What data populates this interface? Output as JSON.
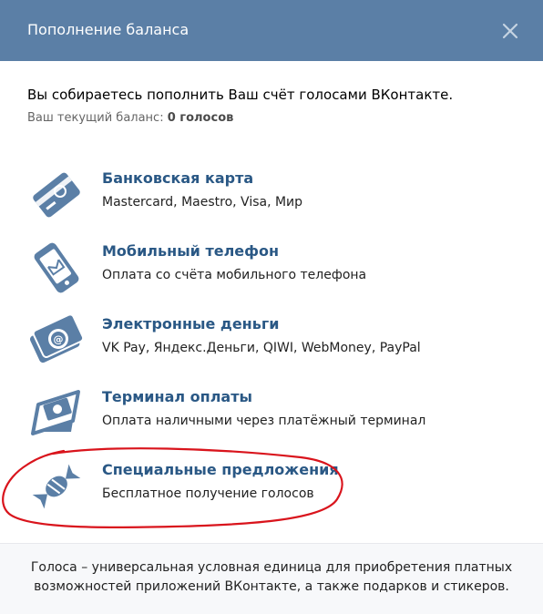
{
  "header": {
    "title": "Пополнение баланса",
    "close_icon": "close-icon",
    "background": "#5b7fa6"
  },
  "intro": {
    "text": "Вы собираетесь пополнить Ваш счёт голосами ВКонтакте.",
    "balance_label": "Ваш текущий баланс:",
    "balance_value": "0 голосов"
  },
  "methods": [
    {
      "title": "Банковская карта",
      "subtitle": "Mastercard, Maestro, Visa, Мир",
      "icon": "bank-card-icon"
    },
    {
      "title": "Мобильный телефон",
      "subtitle": "Оплата со счёта мобильного телефона",
      "icon": "mobile-phone-icon"
    },
    {
      "title": "Электронные деньги",
      "subtitle": "VK Pay, Яндекс.Деньги, QIWI, WebMoney, PayPal",
      "icon": "e-money-icon"
    },
    {
      "title": "Терминал оплаты",
      "subtitle": "Оплата наличными через платёжный терминал",
      "icon": "payment-terminal-icon"
    },
    {
      "title": "Специальные предложения",
      "subtitle": "Бесплатное получение голосов",
      "icon": "candy-icon"
    }
  ],
  "footer": {
    "line1": "Голоса – универсальная условная единица для приобретения платных",
    "line2": "возможностей приложений ВКонтакте, а также подарков и стикеров."
  },
  "colors": {
    "accent": "#2a5885",
    "icon": "#5b7fa6",
    "annotation": "#d9141c"
  }
}
